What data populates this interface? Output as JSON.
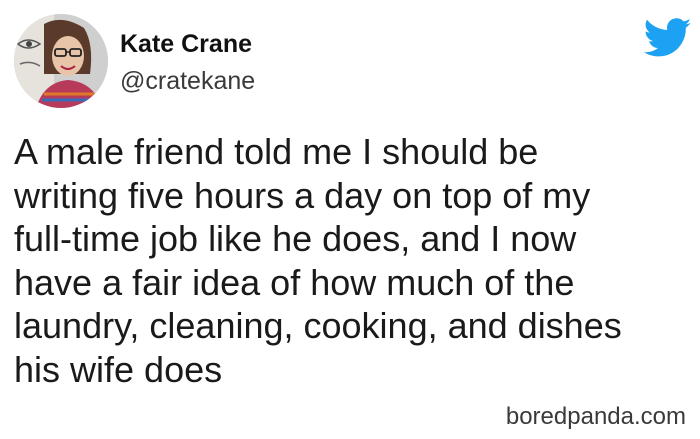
{
  "user": {
    "display_name": "Kate Crane",
    "handle": "@cratekane"
  },
  "icons": {
    "avatar": "profile-photo",
    "brand": "twitter-bird-icon",
    "brand_color": "#1DA1F2"
  },
  "tweet": {
    "lines": [
      "A male friend told me I should be",
      "writing five hours a day on top of my",
      "full-time job like he does, and I now",
      "have a fair idea of how much of the",
      "laundry, cleaning, cooking, and dishes",
      "his wife does"
    ]
  },
  "watermark": "boredpanda.com"
}
